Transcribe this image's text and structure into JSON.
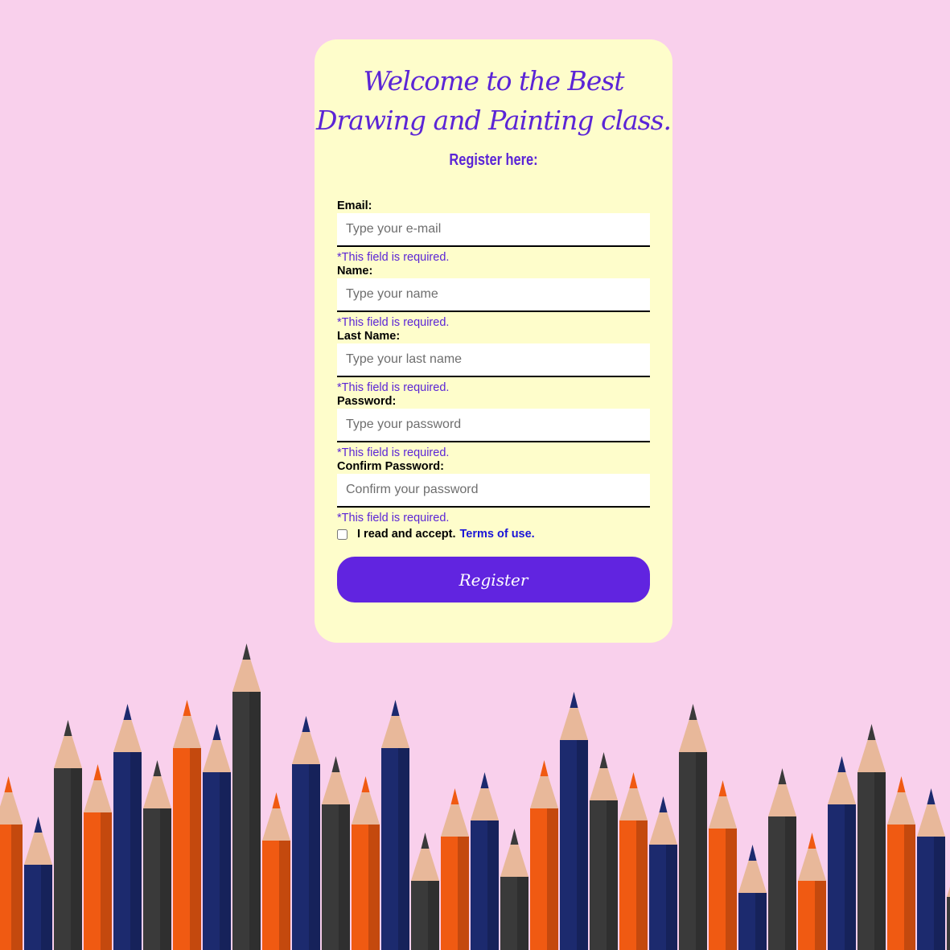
{
  "header": {
    "title_line1": "Welcome to the Best",
    "title_line2": "Drawing and Painting class.",
    "subtitle": "Register here:"
  },
  "form": {
    "fields": [
      {
        "label": "Email:",
        "placeholder": "Type your e-mail",
        "value": "",
        "error": "*This field is required."
      },
      {
        "label": "Name:",
        "placeholder": "Type your name",
        "value": "",
        "error": "*This field is required."
      },
      {
        "label": "Last Name:",
        "placeholder": "Type your last name",
        "value": "",
        "error": "*This field is required."
      },
      {
        "label": "Password:",
        "placeholder": "Type your password",
        "value": "",
        "error": "*This field is required."
      },
      {
        "label": "Confirm Password:",
        "placeholder": "Confirm your password",
        "value": "",
        "error": "*This field is required."
      }
    ],
    "terms_text": "I read and accept.",
    "terms_link": "Terms of use.",
    "terms_checked": false,
    "submit_label": "Register"
  },
  "colors": {
    "page_background": "#f9d0ec",
    "card_background": "#fefdcb",
    "accent": "#5b25d6",
    "button": "#6124e0",
    "link": "#1a14d8"
  },
  "background_image": {
    "icon": "colored-pencils-illustration"
  }
}
